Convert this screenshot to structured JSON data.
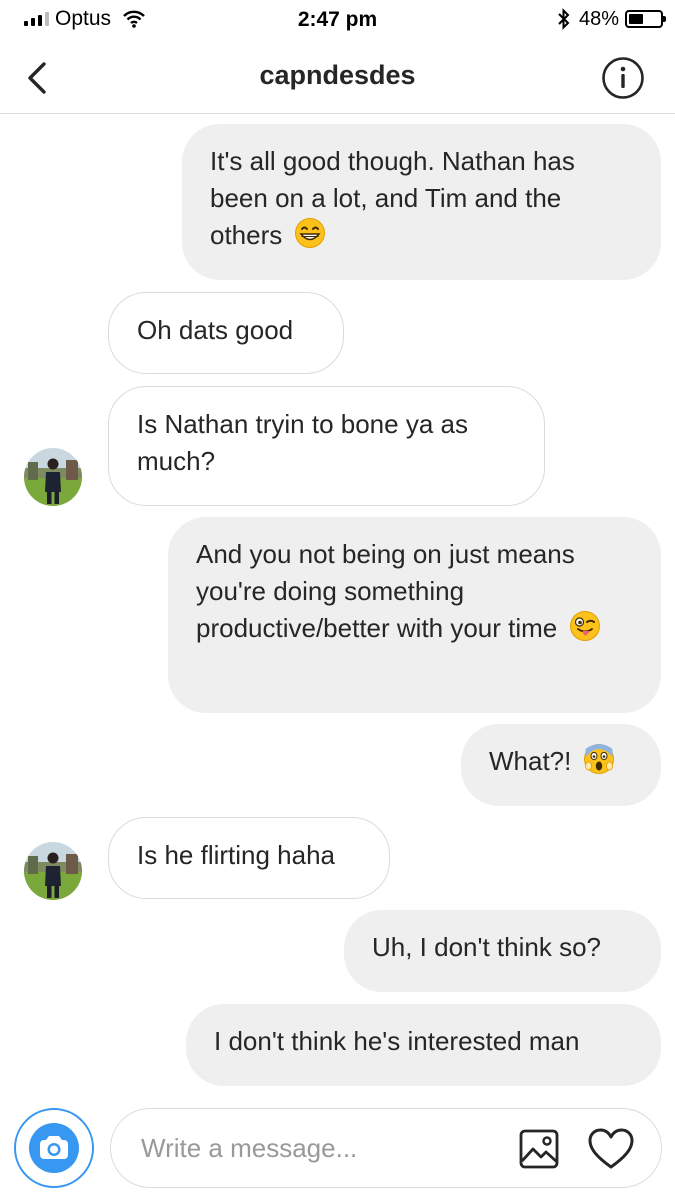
{
  "status_bar": {
    "carrier": "Optus",
    "time": "2:47 pm",
    "battery_percent": "48%",
    "battery_level": 0.48,
    "icons": [
      "signal-icon",
      "wifi-icon",
      "bluetooth-icon",
      "battery-icon"
    ]
  },
  "header": {
    "title": "capndesdes",
    "back_icon": "chevron-left-icon",
    "info_icon": "info-icon"
  },
  "messages": [
    {
      "direction": "outgoing",
      "text": "It's all good though. Nathan has been on a lot, and Tim and the others",
      "emoji": "grinning-face"
    },
    {
      "direction": "incoming",
      "text": "Oh dats good"
    },
    {
      "direction": "incoming",
      "text": "Is Nathan tryin to bone ya as much?",
      "avatar": true
    },
    {
      "direction": "outgoing",
      "text": "And you not being on just means you're doing something productive/better with your time",
      "emoji": "winking-tongue-face"
    },
    {
      "direction": "outgoing",
      "text": "What?!",
      "emoji": "screaming-face"
    },
    {
      "direction": "incoming",
      "text": "Is he flirting haha",
      "avatar": true
    },
    {
      "direction": "outgoing",
      "text": "Uh, I don't think so?"
    },
    {
      "direction": "outgoing",
      "text": "I don't think he's interested man"
    }
  ],
  "composer": {
    "placeholder": "Write a message...",
    "value": "",
    "camera_icon": "camera-icon",
    "gallery_icon": "image-icon",
    "like_icon": "heart-icon"
  },
  "colors": {
    "accent": "#3897f0",
    "outgoing_bubble": "#efefef",
    "incoming_border": "#dbdbdb",
    "text": "#262626",
    "placeholder": "#999999"
  }
}
